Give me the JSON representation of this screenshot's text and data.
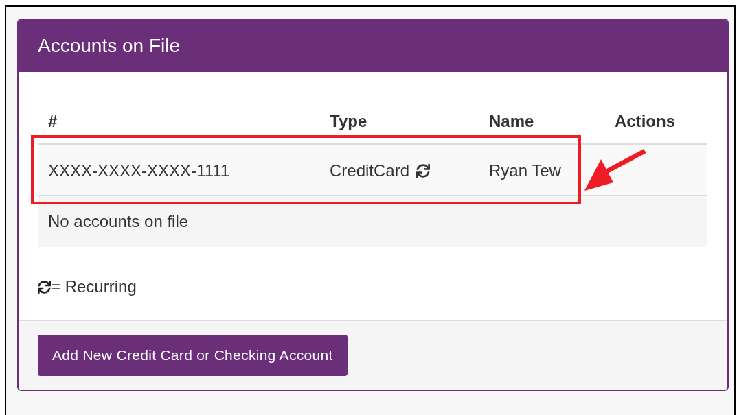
{
  "panel": {
    "title": "Accounts on File"
  },
  "table": {
    "columns": [
      "#",
      "Type",
      "Name",
      "Actions"
    ],
    "rows": [
      {
        "kind": "account",
        "number": "XXXX-XXXX-XXXX-1111",
        "type": "CreditCard",
        "recurring": true,
        "name": "Ryan Tew"
      },
      {
        "kind": "message",
        "text": "No accounts on file"
      }
    ]
  },
  "legend": {
    "text": "= Recurring"
  },
  "button": {
    "label": "Add New Credit Card or Checking Account"
  },
  "annotation": {
    "highlight": true,
    "arrow": true
  }
}
